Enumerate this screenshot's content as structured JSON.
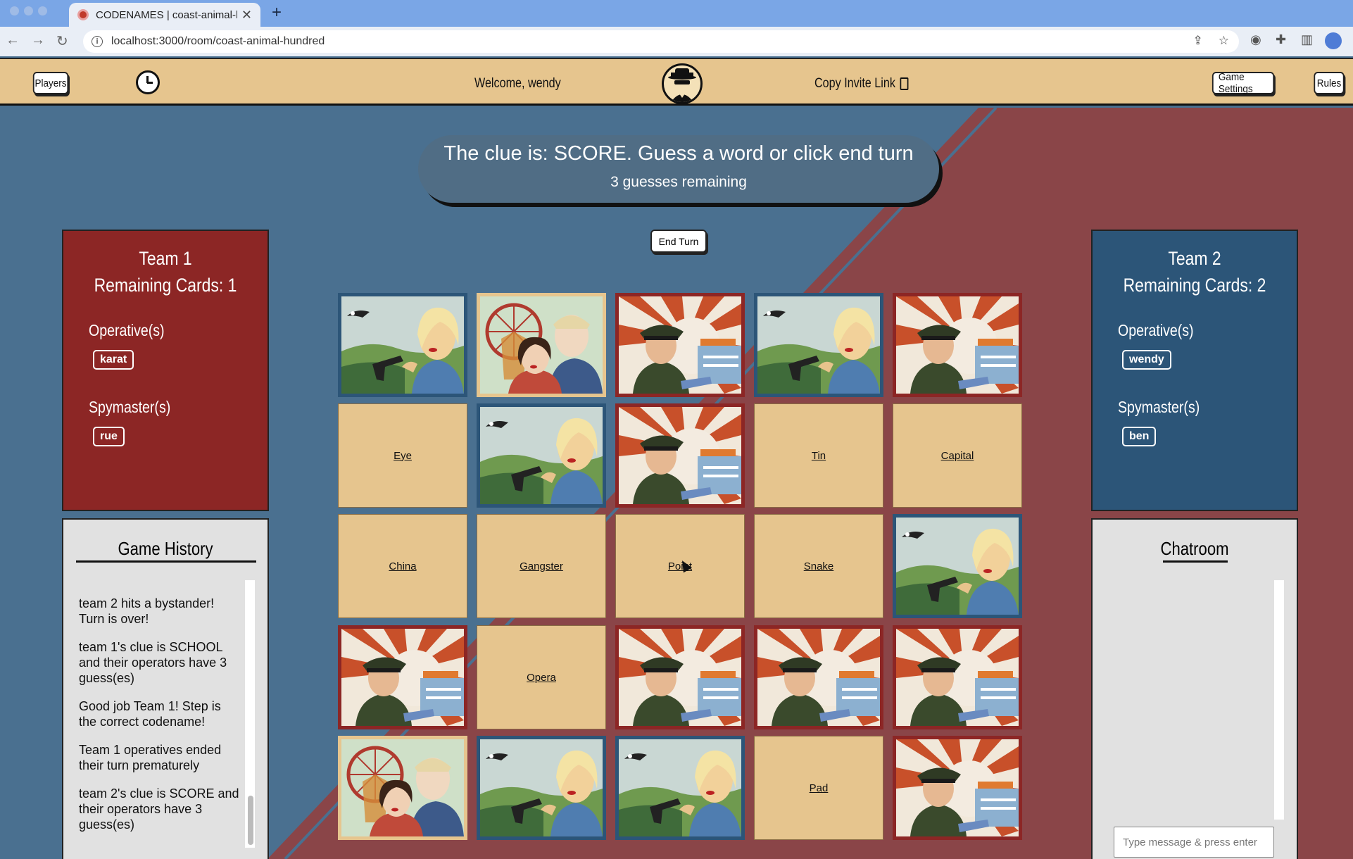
{
  "browser": {
    "tab_title": "CODENAMES | coast-animal-h",
    "tab_close": "✕",
    "new_tab": "+",
    "url": "localhost:3000/room/coast-animal-hundred"
  },
  "header": {
    "players_label": "Players",
    "welcome": "Welcome, wendy",
    "invite_label": "Copy Invite Link",
    "settings_label": "Game Settings",
    "rules_label": "Rules"
  },
  "clue": {
    "text": "The clue is: SCORE. Guess a word or click end turn",
    "remaining": "3 guesses remaining"
  },
  "end_turn_label": "End Turn",
  "team1": {
    "name": "Team 1",
    "remaining": "Remaining Cards: 1",
    "operative_label": "Operative(s)",
    "operative": "karat",
    "spymaster_label": "Spymaster(s)",
    "spymaster": "rue"
  },
  "team2": {
    "name": "Team 2",
    "remaining": "Remaining Cards: 2",
    "operative_label": "Operative(s)",
    "operative": "wendy",
    "spymaster_label": "Spymaster(s)",
    "spymaster": "ben"
  },
  "history": {
    "title": "Game History",
    "entries": [
      "team 2 hits a bystander! Turn is over!",
      "team 1's clue is SCHOOL and their operators have 3 guess(es)",
      "Good job Team 1! Step is the correct codename!",
      "Team 1 operatives ended their turn prematurely",
      "team 2's clue is SCORE and their operators have 3 guess(es)"
    ]
  },
  "chat": {
    "title": "Chatroom",
    "placeholder": "Type message & press enter"
  },
  "board": [
    {
      "kind": "blue",
      "word": ""
    },
    {
      "kind": "neutral",
      "word": ""
    },
    {
      "kind": "red",
      "word": ""
    },
    {
      "kind": "blue",
      "word": ""
    },
    {
      "kind": "red",
      "word": ""
    },
    {
      "kind": "word",
      "word": "Eye"
    },
    {
      "kind": "blue",
      "word": ""
    },
    {
      "kind": "red",
      "word": ""
    },
    {
      "kind": "word",
      "word": "Tin"
    },
    {
      "kind": "word",
      "word": "Capital"
    },
    {
      "kind": "word",
      "word": "China"
    },
    {
      "kind": "word",
      "word": "Gangster"
    },
    {
      "kind": "word",
      "word": "Point"
    },
    {
      "kind": "word",
      "word": "Snake"
    },
    {
      "kind": "blue",
      "word": ""
    },
    {
      "kind": "red",
      "word": ""
    },
    {
      "kind": "word",
      "word": "Opera"
    },
    {
      "kind": "red",
      "word": ""
    },
    {
      "kind": "red",
      "word": ""
    },
    {
      "kind": "red",
      "word": ""
    },
    {
      "kind": "neutral",
      "word": ""
    },
    {
      "kind": "blue",
      "word": ""
    },
    {
      "kind": "blue",
      "word": ""
    },
    {
      "kind": "word",
      "word": "Pad"
    },
    {
      "kind": "red",
      "word": ""
    }
  ],
  "colors": {
    "red_team": "#8c2625",
    "blue_team": "#2c5578",
    "card_tan": "#e6c58e",
    "board_blue": "#4a7090",
    "board_red": "#8a4548"
  }
}
